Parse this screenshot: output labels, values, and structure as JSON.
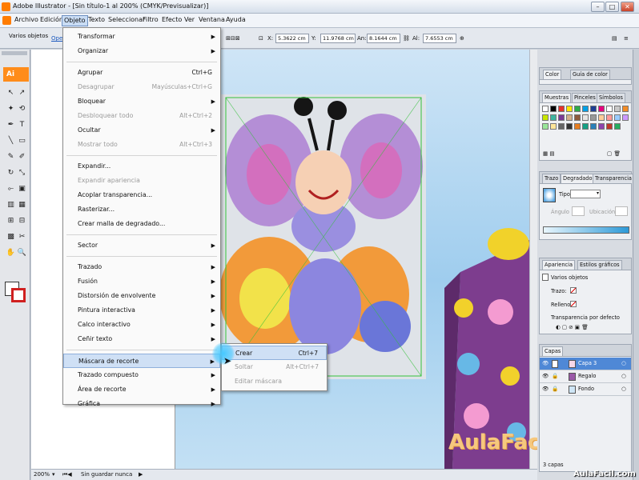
{
  "window": {
    "title": "Adobe Illustrator - [Sin título-1 al 200% (CMYK/Previsualizar)]",
    "minimize": "–",
    "maximize": "□",
    "close": "✕"
  },
  "menubar": {
    "items": [
      "Archivo",
      "Edición",
      "Objeto",
      "Texto",
      "Seleccionar",
      "Filtro",
      "Efecto",
      "Ver",
      "Ventana",
      "Ayuda"
    ],
    "active": "Objeto"
  },
  "controlbar": {
    "selection_label": "Varios objetos",
    "opacity_label": "Ope",
    "x_label": "X:",
    "x_value": "5.3622 cm",
    "y_label": "Y:",
    "y_value": "11.9768 cm",
    "w_label": "An:",
    "w_value": "8.1644 cm",
    "h_label": "Al:",
    "h_value": "7.6553 cm"
  },
  "toolbox": {
    "logo": "Ai"
  },
  "dropdown": {
    "items": [
      {
        "label": "Transformar",
        "submenu": true
      },
      {
        "label": "Organizar",
        "submenu": true
      },
      {
        "sep": true
      },
      {
        "label": "Agrupar",
        "shortcut": "Ctrl+G"
      },
      {
        "label": "Desagrupar",
        "shortcut": "Mayúsculas+Ctrl+G",
        "disabled": true
      },
      {
        "label": "Bloquear",
        "submenu": true
      },
      {
        "label": "Desbloquear todo",
        "shortcut": "Alt+Ctrl+2",
        "disabled": true
      },
      {
        "label": "Ocultar",
        "submenu": true
      },
      {
        "label": "Mostrar todo",
        "shortcut": "Alt+Ctrl+3",
        "disabled": true
      },
      {
        "sep": true
      },
      {
        "label": "Expandir..."
      },
      {
        "label": "Expandir apariencia",
        "disabled": true
      },
      {
        "label": "Acoplar transparencia..."
      },
      {
        "label": "Rasterizar..."
      },
      {
        "label": "Crear malla de degradado..."
      },
      {
        "sep": true
      },
      {
        "label": "Sector",
        "submenu": true
      },
      {
        "sep": true
      },
      {
        "label": "Trazado",
        "submenu": true
      },
      {
        "label": "Fusión",
        "submenu": true
      },
      {
        "label": "Distorsión de envolvente",
        "submenu": true
      },
      {
        "label": "Pintura interactiva",
        "submenu": true
      },
      {
        "label": "Calco interactivo",
        "submenu": true
      },
      {
        "label": "Ceñir texto",
        "submenu": true
      },
      {
        "sep": true
      },
      {
        "label": "Máscara de recorte",
        "submenu": true,
        "highlight": true
      },
      {
        "label": "Trazado compuesto",
        "submenu": true
      },
      {
        "label": "Área de recorte",
        "submenu": true
      },
      {
        "label": "Gráfica",
        "submenu": true
      }
    ]
  },
  "submenu": {
    "items": [
      {
        "label": "Crear",
        "shortcut": "Ctrl+7",
        "highlight": true
      },
      {
        "label": "Soltar",
        "shortcut": "Alt+Ctrl+7",
        "disabled": true
      },
      {
        "label": "Editar máscara",
        "disabled": true
      }
    ]
  },
  "panels": {
    "color_tabs": [
      "Color",
      "Guía de color"
    ],
    "swatch_tabs": [
      "Muestras",
      "Pinceles",
      "Símbolos"
    ],
    "gradient_tabs": [
      "Trazo",
      "Degradado",
      "Transparencia"
    ],
    "gradient_type_label": "Tipo:",
    "gradient_angle_label": "Ángulo",
    "gradient_location_label": "Ubicación",
    "appearance_tabs": [
      "Apariencia",
      "Estilos gráficos"
    ],
    "appearance_title": "Varios objetos",
    "appearance_rows": [
      "Trazo:",
      "Relleno:",
      "Transparencia por defecto"
    ],
    "layers_tab": "Capas",
    "layers": [
      {
        "name": "Capa 3",
        "selected": true
      },
      {
        "name": "Regalo"
      },
      {
        "name": "Fondo"
      }
    ],
    "layers_count": "3 capas",
    "swatch_colors": [
      "#ffffff",
      "#000000",
      "#e6312b",
      "#ffe600",
      "#2eaa4a",
      "#00a0e6",
      "#1d3f94",
      "#e5007e",
      "#ffffff",
      "#c8c8c8",
      "#f28c28",
      "#c8e600",
      "#3cb4a0",
      "#7b3a96",
      "#d3b08c",
      "#8c5a3c",
      "#e6e6e6",
      "#999999",
      "#ffcc99",
      "#ff9999",
      "#99ccff",
      "#cc99ff",
      "#99e699",
      "#ffe699",
      "#666666",
      "#333333",
      "#e67e22",
      "#16a085",
      "#2980b9",
      "#8e44ad",
      "#c0392b",
      "#27ae60"
    ]
  },
  "status": {
    "zoom": "200%",
    "state": "Sin guardar nunca"
  },
  "watermark": {
    "big": "AulaFacil.com",
    "small": "AulaFacil.com"
  }
}
